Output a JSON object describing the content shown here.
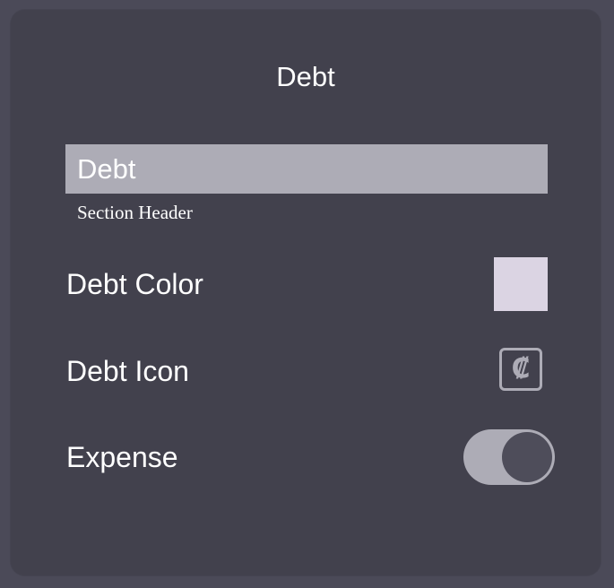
{
  "dialog": {
    "title": "Debt"
  },
  "name_field": {
    "value": "Debt",
    "caption": "Section Header"
  },
  "color_row": {
    "label": "Debt Color",
    "swatch_color": "#dbd4e3"
  },
  "icon_row": {
    "label": "Debt Icon",
    "icon_name": "colon-currency-icon",
    "icon_glyph": "₡"
  },
  "expense_row": {
    "label": "Expense",
    "toggle_on": true
  },
  "colors": {
    "background": "#4b4a58",
    "panel": "#42414d",
    "field": "#adacb6",
    "text": "#ffffff"
  }
}
